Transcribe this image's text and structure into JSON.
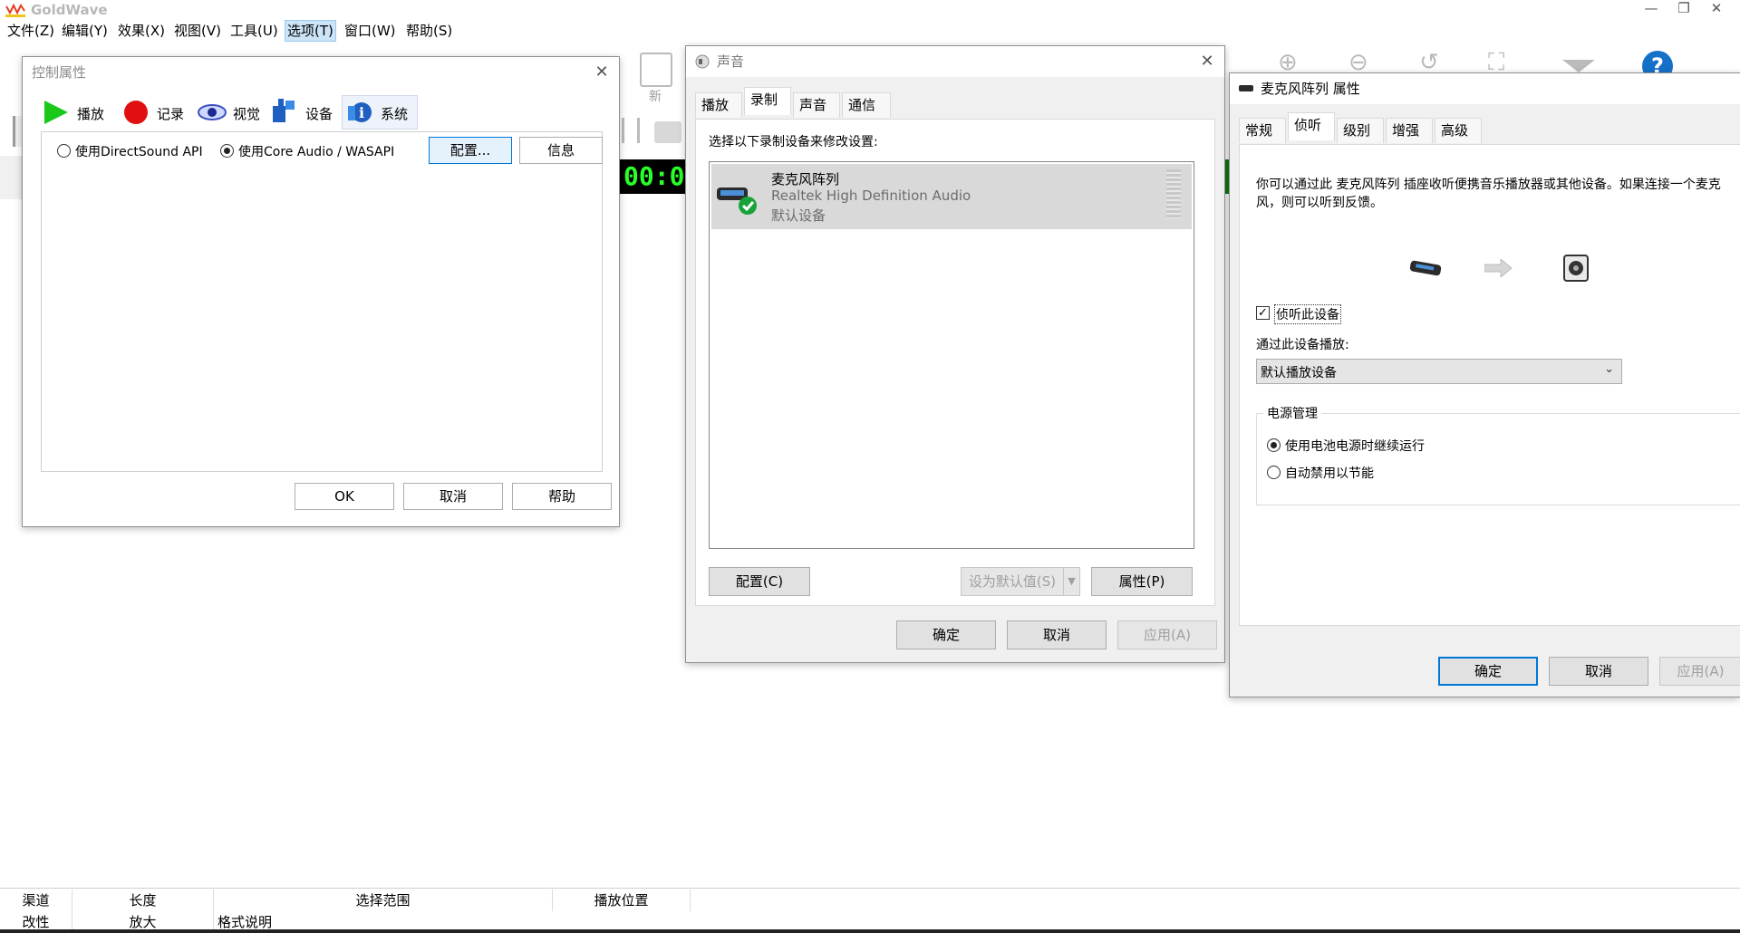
{
  "app": {
    "title": "GoldWave",
    "menu": [
      "文件(Z)",
      "编辑(Y)",
      "效果(X)",
      "视图(V)",
      "工具(U)",
      "选项(T)",
      "窗口(W)",
      "帮助(S)"
    ],
    "toolbar_new": "新",
    "time": "00:00",
    "status_top": [
      "渠道",
      "长度",
      "选择范围",
      "播放位置"
    ],
    "status_bottom": [
      "改性",
      "放大",
      "格式说明"
    ],
    "accent": "#0078d7"
  },
  "control": {
    "title": "控制属性",
    "tabs": [
      "播放",
      "记录",
      "视觉",
      "设备",
      "系统"
    ],
    "radio_directsound": "使用DirectSound API",
    "radio_coreaudio": "使用Core Audio / WASAPI",
    "config_btn": "配置...",
    "info_btn": "信息",
    "ok_btn": "OK",
    "cancel_btn": "取消",
    "help_btn": "帮助"
  },
  "sound": {
    "title": "声音",
    "tabs": [
      "播放",
      "录制",
      "声音",
      "通信"
    ],
    "instruction": "选择以下录制设备来修改设置:",
    "device_name": "麦克风阵列",
    "device_driver": "Realtek High Definition Audio",
    "device_status": "默认设备",
    "configure_btn": "配置(C)",
    "set_default_btn": "设为默认值(S)",
    "properties_btn": "属性(P)",
    "ok_btn": "确定",
    "cancel_btn": "取消",
    "apply_btn": "应用(A)"
  },
  "mic": {
    "title": "麦克风阵列 属性",
    "tabs": [
      "常规",
      "侦听",
      "级别",
      "增强",
      "高级"
    ],
    "description": "你可以通过此 麦克风阵列 插座收听便携音乐播放器或其他设备。如果连接一个麦克风，则可以听到反馈。",
    "listen_checkbox": "侦听此设备",
    "playback_label": "通过此设备播放:",
    "playback_value": "默认播放设备",
    "power_group": "电源管理",
    "power_continue": "使用电池电源时继续运行",
    "power_disable": "自动禁用以节能",
    "ok_btn": "确定",
    "cancel_btn": "取消",
    "apply_btn": "应用(A)"
  }
}
